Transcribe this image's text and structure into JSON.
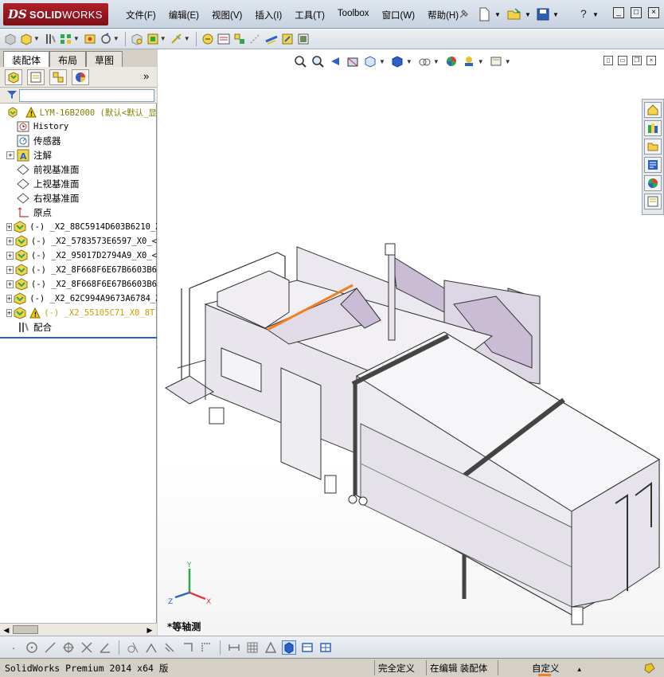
{
  "app": {
    "logo_ds": "DS",
    "logo_name_bold": "SOLID",
    "logo_name_light": "WORKS"
  },
  "menu": [
    {
      "label": "文件(F)"
    },
    {
      "label": "编辑(E)"
    },
    {
      "label": "视图(V)"
    },
    {
      "label": "插入(I)"
    },
    {
      "label": "工具(T)"
    },
    {
      "label": "Toolbox"
    },
    {
      "label": "窗口(W)"
    },
    {
      "label": "帮助(H)"
    }
  ],
  "window_controls": {
    "help": "?",
    "minimize": "_",
    "restore": "□",
    "close": "×"
  },
  "left_panel": {
    "tabs": [
      {
        "label": "装配体",
        "active": true
      },
      {
        "label": "布局",
        "active": false
      },
      {
        "label": "草图",
        "active": false
      }
    ],
    "more": "»",
    "tree": [
      {
        "level": 0,
        "expander": "",
        "icon": "assembly-warning-icon",
        "text": "LYM-16B2000  (默认<默认_显",
        "style": "top",
        "warning": true
      },
      {
        "level": 1,
        "expander": "",
        "icon": "history-icon",
        "text": "History",
        "style": "mono"
      },
      {
        "level": 1,
        "expander": "",
        "icon": "sensor-icon",
        "text": "传感器",
        "style": "cn"
      },
      {
        "level": 1,
        "expander": "+",
        "icon": "annotation-icon",
        "text": "注解",
        "style": "cn"
      },
      {
        "level": 1,
        "expander": "",
        "icon": "plane-icon",
        "text": "前视基准面",
        "style": "cn"
      },
      {
        "level": 1,
        "expander": "",
        "icon": "plane-icon",
        "text": "上视基准面",
        "style": "cn"
      },
      {
        "level": 1,
        "expander": "",
        "icon": "plane-icon",
        "text": "右视基准面",
        "style": "cn"
      },
      {
        "level": 1,
        "expander": "",
        "icon": "origin-icon",
        "text": "原点",
        "style": "cn"
      },
      {
        "level": 1,
        "expander": "+",
        "icon": "subassembly-icon",
        "text": "(-) _X2_88C5914D603B6210_X",
        "style": "mono"
      },
      {
        "level": 1,
        "expander": "+",
        "icon": "subassembly-icon",
        "text": "(-) _X2_5783573E6597_X0_<",
        "style": "mono"
      },
      {
        "level": 1,
        "expander": "+",
        "icon": "subassembly-icon",
        "text": "(-) _X2_95017D2794A9_X0_<",
        "style": "mono"
      },
      {
        "level": 1,
        "expander": "+",
        "icon": "subassembly-icon",
        "text": "(-) _X2_8F668F6E67B6603B6",
        "style": "mono"
      },
      {
        "level": 1,
        "expander": "+",
        "icon": "subassembly-icon",
        "text": "(-) _X2_8F668F6E67B6603B6",
        "style": "mono"
      },
      {
        "level": 1,
        "expander": "+",
        "icon": "subassembly-icon",
        "text": "(-) _X2_62C994A9673A6784_X",
        "style": "mono"
      },
      {
        "level": 1,
        "expander": "+",
        "icon": "subassembly-warning-icon",
        "text": "(-) _X2_55105C71_X0_8T_",
        "style": "warnchild",
        "warning": true
      },
      {
        "level": 1,
        "expander": "",
        "icon": "mates-icon",
        "text": "配合",
        "style": "cn"
      }
    ]
  },
  "viewport": {
    "view_name": "*等轴测",
    "triad": {
      "x": "X",
      "y": "Y",
      "z": "Z"
    }
  },
  "statusbar": {
    "app_name": "SolidWorks Premium 2014 x64 版",
    "definition": "完全定义",
    "mode": "在编辑 装配体",
    "units": "自定义",
    "units_arrow": "▲"
  },
  "colors": {
    "model_fill": "#e8e6ec",
    "model_accent": "#c9bcd4",
    "orange_edge": "#f08020",
    "title_red": "#a01620"
  }
}
